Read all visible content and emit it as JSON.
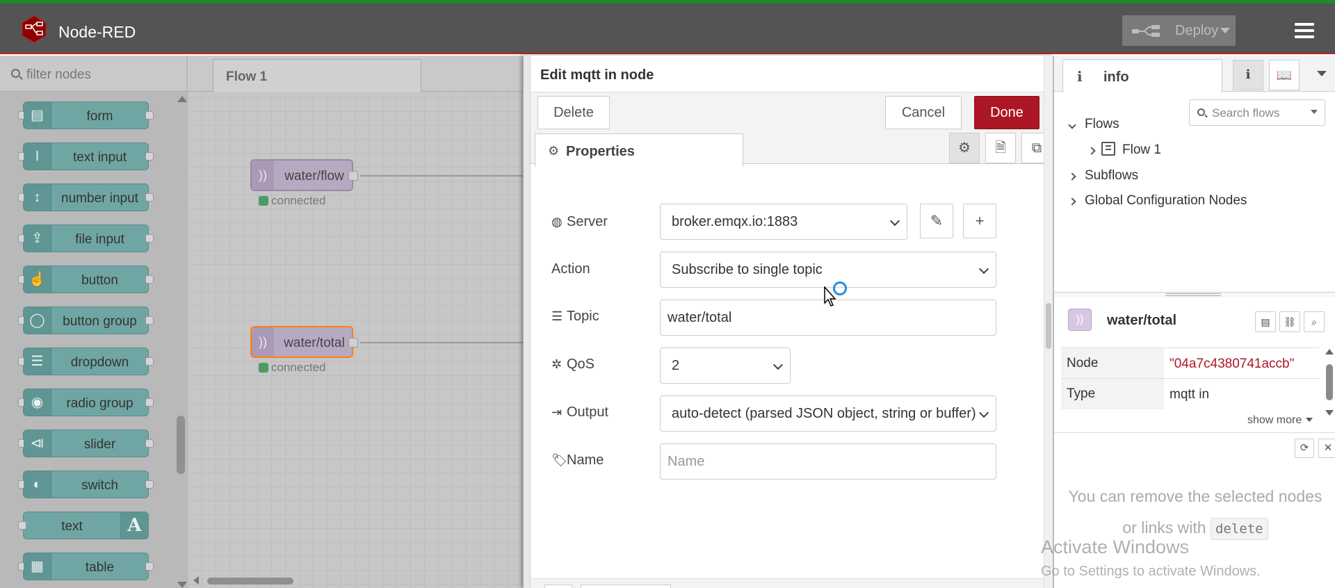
{
  "app": {
    "title": "Node-RED",
    "deploy_label": "Deploy"
  },
  "palette": {
    "search_placeholder": "filter nodes",
    "nodes": [
      {
        "label": "form",
        "icon": "form-icon"
      },
      {
        "label": "text input",
        "icon": "text-cursor-icon"
      },
      {
        "label": "number input",
        "icon": "arrows-updown-icon"
      },
      {
        "label": "file input",
        "icon": "upload-icon"
      },
      {
        "label": "button",
        "icon": "hand-pointer-icon"
      },
      {
        "label": "button group",
        "icon": "toggle-group-icon"
      },
      {
        "label": "dropdown",
        "icon": "list-icon"
      },
      {
        "label": "radio group",
        "icon": "radio-icon"
      },
      {
        "label": "slider",
        "icon": "sliders-icon"
      },
      {
        "label": "switch",
        "icon": "toggle-icon"
      },
      {
        "label": "text",
        "icon": "letter-a-icon",
        "icon_glyph": "A"
      },
      {
        "label": "table",
        "icon": "table-icon"
      }
    ]
  },
  "workspace": {
    "tab": "Flow 1",
    "nodes": [
      {
        "label": "water/flow",
        "status": "connected"
      },
      {
        "label": "water/total",
        "status": "connected"
      }
    ]
  },
  "editor": {
    "title": "Edit mqtt in node",
    "delete_label": "Delete",
    "cancel_label": "Cancel",
    "done_label": "Done",
    "properties_tab": "Properties",
    "fields": {
      "server_label": "Server",
      "server_value": "broker.emqx.io:1883",
      "action_label": "Action",
      "action_value": "Subscribe to single topic",
      "topic_label": "Topic",
      "topic_value": "water/total",
      "qos_label": "QoS",
      "qos_value": "2",
      "output_label": "Output",
      "output_value": "auto-detect (parsed JSON object, string or buffer)",
      "name_label": "Name",
      "name_placeholder": "Name"
    }
  },
  "sidebar": {
    "tab_label": "info",
    "search_placeholder": "Search flows",
    "tree": {
      "flows": "Flows",
      "flow1": "Flow 1",
      "subflows": "Subflows",
      "global": "Global Configuration Nodes"
    },
    "selected_node": {
      "title": "water/total",
      "rows": [
        {
          "key": "Node",
          "value": "\"04a7c4380741accb\""
        },
        {
          "key": "Type",
          "value": "mqtt in"
        }
      ],
      "show_more": "show more"
    },
    "tip": {
      "text": "You can remove the selected nodes or links with",
      "code": "delete"
    }
  },
  "watermark": {
    "line1": "Activate Windows",
    "line2": "Go to Settings to activate Windows."
  },
  "colors": {
    "header": "#545454",
    "done": "#ad1625",
    "node_teal": "#6fa6a3",
    "mqtt_node": "#b8a9c3"
  }
}
